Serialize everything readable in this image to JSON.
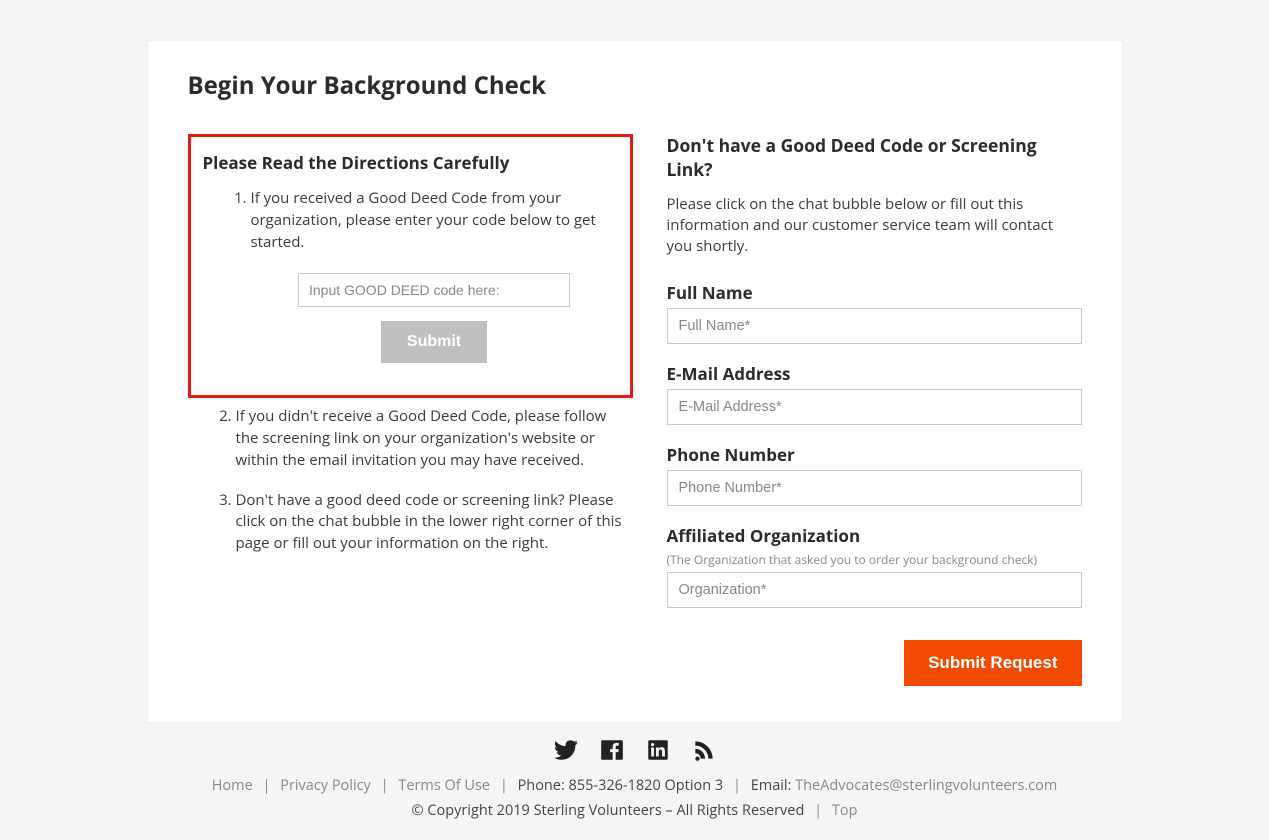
{
  "page": {
    "title": "Begin Your Background Check"
  },
  "directions": {
    "heading": "Please Read the Directions Carefully",
    "item1": "If you received a Good Deed Code from your organization, please enter your code below to get started.",
    "code_placeholder": "Input GOOD DEED code here:",
    "submit_label": "Submit",
    "item2": "If you didn't receive a Good Deed Code, please follow the screening link on your organization's website or within the email invitation you may have received.",
    "item3": "Don't have a good deed code or screening link? Please click on the chat bubble in the lower right corner of this page or fill out your information on the right."
  },
  "contact_form": {
    "heading": "Don't have a Good Deed Code or Screening Link?",
    "lede": "Please click on the chat bubble below or fill out this information and our customer service team will contact you shortly.",
    "full_name_label": "Full Name",
    "full_name_placeholder": "Full Name*",
    "email_label": "E-Mail Address",
    "email_placeholder": "E-Mail Address*",
    "phone_label": "Phone Number",
    "phone_placeholder": "Phone Number*",
    "org_label": "Affiliated Organization",
    "org_note": "(The Organization that asked you to order your background check)",
    "org_placeholder": "Organization*",
    "submit_label": "Submit Request"
  },
  "footer": {
    "home": "Home",
    "privacy": "Privacy Policy",
    "terms": "Terms Of Use",
    "phone_label": "Phone: 855-326-1820 Option 3",
    "email_prefix": "Email:",
    "email_address": "TheAdvocates@sterlingvolunteers.com",
    "copyright": "© Copyright 2019 Sterling Volunteers – All Rights Reserved",
    "top": "Top"
  }
}
